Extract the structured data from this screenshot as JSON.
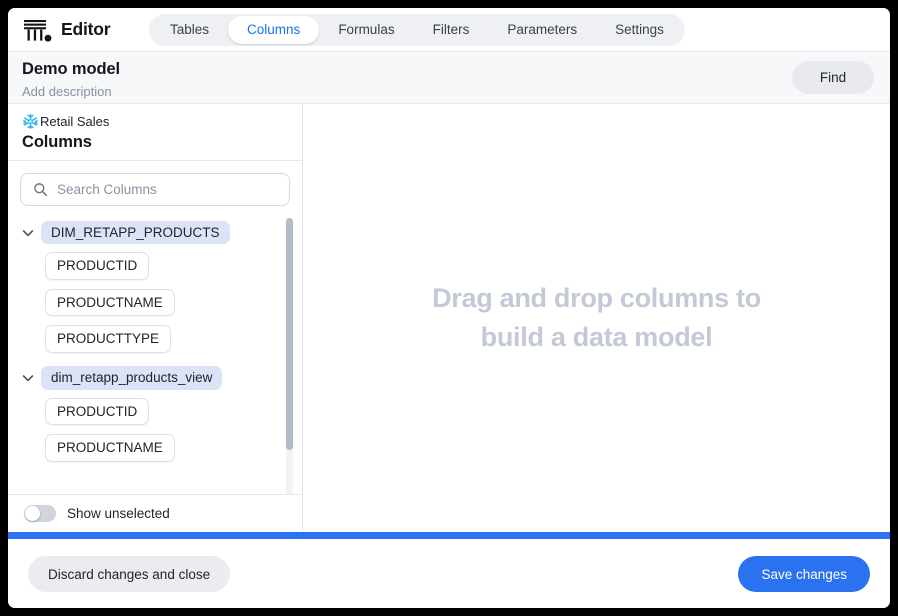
{
  "app": {
    "title": "Editor",
    "logo_icon": "pillar-logo-icon"
  },
  "tabs": [
    {
      "label": "Tables",
      "active": false
    },
    {
      "label": "Columns",
      "active": true
    },
    {
      "label": "Formulas",
      "active": false
    },
    {
      "label": "Filters",
      "active": false
    },
    {
      "label": "Parameters",
      "active": false
    },
    {
      "label": "Settings",
      "active": false
    }
  ],
  "model_header": {
    "title": "Demo model",
    "description_placeholder": "Add description",
    "find_label": "Find"
  },
  "sidebar": {
    "source_name": "Retail Sales",
    "source_icon": "snowflake-icon",
    "heading": "Columns",
    "search": {
      "placeholder": "Search Columns",
      "value": "",
      "icon": "search-icon"
    },
    "groups": [
      {
        "name": "DIM_RETAPP_PRODUCTS",
        "expanded": true,
        "chevron_icon": "chevron-down-icon",
        "columns": [
          "PRODUCTID",
          "PRODUCTNAME",
          "PRODUCTTYPE"
        ]
      },
      {
        "name": "dim_retapp_products_view",
        "expanded": true,
        "chevron_icon": "chevron-down-icon",
        "columns": [
          "PRODUCTID",
          "PRODUCTNAME"
        ]
      }
    ],
    "show_unselected": {
      "label": "Show unselected",
      "on": false
    }
  },
  "canvas": {
    "empty_line1": "Drag and drop columns to",
    "empty_line2": "build a data model"
  },
  "footer": {
    "discard_label": "Discard changes and close",
    "save_label": "Save changes"
  },
  "colors": {
    "accent_blue": "#2a72ef",
    "tab_active_text": "#1a73f0",
    "group_pill_bg": "#dde3f7",
    "snowflake_blue": "#29b5e8",
    "empty_state_text": "#c3c9d6"
  }
}
